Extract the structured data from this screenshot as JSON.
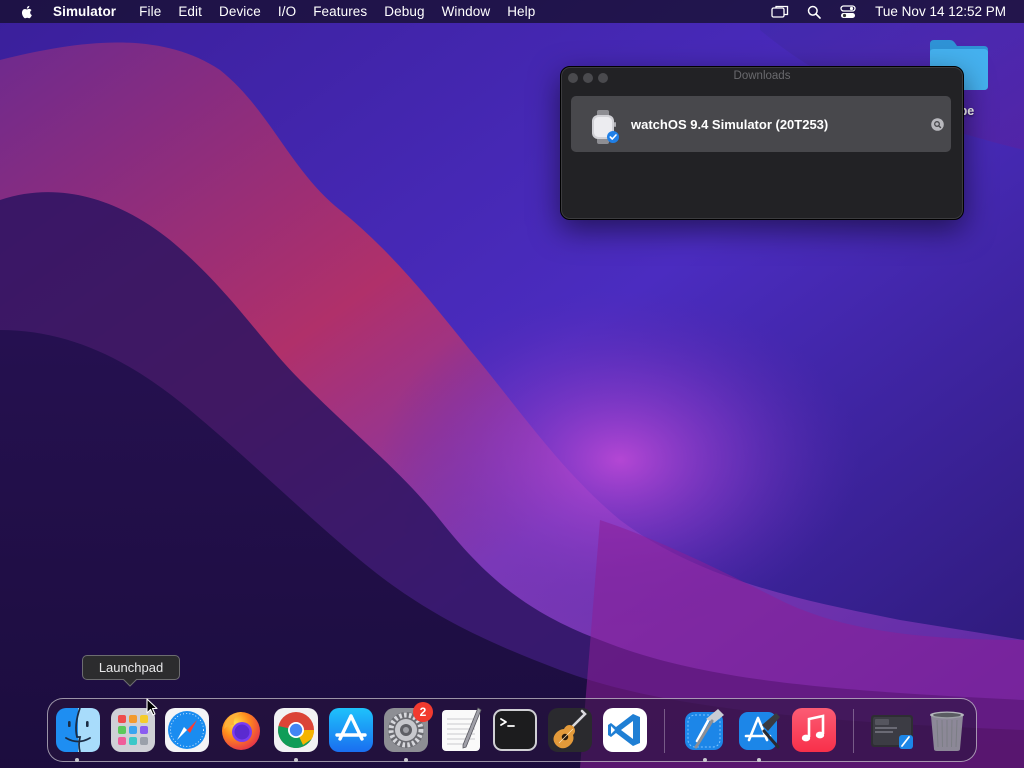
{
  "menubar": {
    "app_name": "Simulator",
    "menus": [
      "File",
      "Edit",
      "Device",
      "I/O",
      "Features",
      "Debug",
      "Window",
      "Help"
    ],
    "clock": "Tue Nov 14  12:52 PM",
    "status_icons": [
      "screen-mirroring-icon",
      "search-icon",
      "control-center-icon"
    ]
  },
  "desktop": {
    "folder_label": "ube",
    "folder_color": "#34a3e6"
  },
  "downloads_window": {
    "title": "Downloads",
    "item_name": "watchOS 9.4 Simulator (20T253)"
  },
  "tooltip": {
    "text": "Launchpad"
  },
  "dock": {
    "apps": [
      "finder",
      "launchpad",
      "safari",
      "firefox",
      "chrome",
      "app-store",
      "system-settings",
      "textedit",
      "terminal",
      "garageband",
      "vs-code",
      "xcode",
      "simulator",
      "music",
      "downloads-stack",
      "trash"
    ],
    "settings_badge": "2"
  },
  "colors": {
    "wallpaper_dark": "#1e0f4a",
    "wallpaper_magenta": "#a0208a",
    "wallpaper_blue": "#3f2fb8"
  }
}
